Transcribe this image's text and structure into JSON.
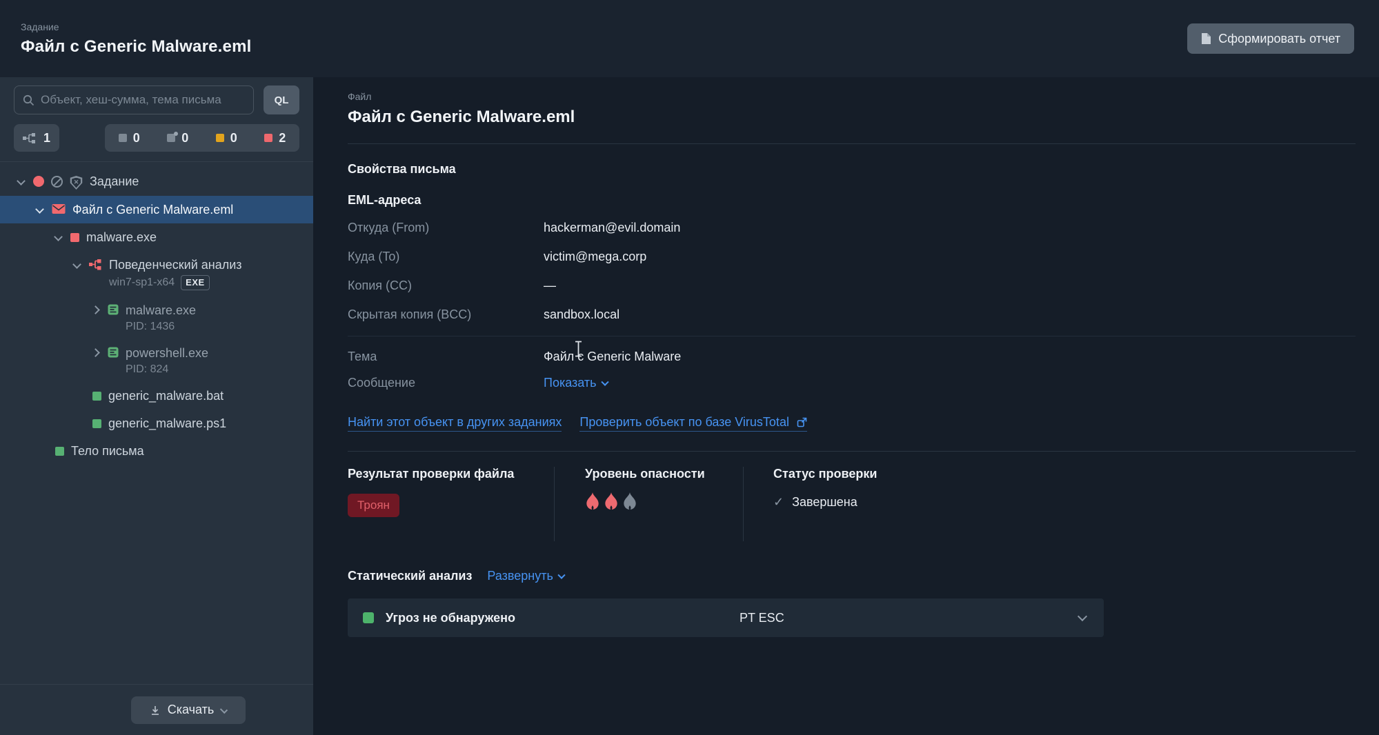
{
  "header": {
    "kicker": "Задание",
    "title": "Файл с Generic Malware.eml",
    "report_button": "Сформировать отчет"
  },
  "sidebar": {
    "search_placeholder": "Объект, хеш-сумма, тема письма",
    "ql_button": "QL",
    "tree_counter": "1",
    "severity_counters": [
      {
        "name": "neutral",
        "style": "square",
        "color": "#7e8994",
        "value": "0"
      },
      {
        "name": "unchecked",
        "style": "square-dot",
        "color": "#7e8994",
        "value": "0"
      },
      {
        "name": "suspicious",
        "style": "square",
        "color": "#e2a41d",
        "value": "0"
      },
      {
        "name": "dangerous",
        "style": "square",
        "color": "#ee686d",
        "value": "2"
      }
    ],
    "tree": [
      {
        "label": "Задание",
        "level": 0,
        "chevron": "down",
        "icons": [
          "red-dot",
          "ban",
          "shield-x"
        ]
      },
      {
        "label": "Файл с Generic Malware.eml",
        "level": 1,
        "chevron": "down",
        "icons": [
          "envelope"
        ],
        "selected": true
      },
      {
        "label": "malware.exe",
        "level": 2,
        "chevron": "down",
        "icons": [
          "red-square"
        ]
      },
      {
        "label": "Поведенческий анализ",
        "sublabel": "win7-sp1-x64",
        "badge": "EXE",
        "level": 3,
        "chevron": "down",
        "icons": [
          "behavior"
        ]
      },
      {
        "label": "malware.exe",
        "sublabel": "PID: 1436",
        "level": 4,
        "chevron": "right",
        "icons": [
          "process"
        ],
        "dimmed": true
      },
      {
        "label": "powershell.exe",
        "sublabel": "PID: 824",
        "level": 4,
        "chevron": "right",
        "icons": [
          "process"
        ],
        "dimmed": true
      },
      {
        "label": "generic_malware.bat",
        "level": 4,
        "icons": [
          "green-square"
        ]
      },
      {
        "label": "generic_malware.ps1",
        "level": 4,
        "icons": [
          "green-square"
        ]
      },
      {
        "label": "Тело письма",
        "level": 2,
        "icons": [
          "green-square"
        ]
      }
    ],
    "download_button": "Скачать"
  },
  "main": {
    "kicker": "Файл",
    "title": "Файл с Generic Malware.eml",
    "email": {
      "section_title": "Свойства письма",
      "subtitle": "EML-адреса",
      "rows": [
        {
          "label": "Откуда (From)",
          "value": "hackerman@evil.domain"
        },
        {
          "label": "Куда (To)",
          "value": "victim@mega.corp"
        },
        {
          "label": "Копия (CC)",
          "value": "—"
        },
        {
          "label": "Скрытая копия (BCC)",
          "value": "sandbox.local"
        }
      ],
      "subject": {
        "label": "Тема",
        "value": "Файл с Generic Malware"
      },
      "message": {
        "label": "Сообщение",
        "link": "Показать"
      }
    },
    "links": [
      "Найти этот объект в других заданиях",
      "Проверить объект по базе VirusTotal"
    ],
    "verdict": {
      "result_title": "Результат проверки файла",
      "result_badge": "Троян",
      "danger_title": "Уровень опасности",
      "danger_level": 2,
      "danger_max": 3,
      "status_title": "Статус проверки",
      "status_value": "Завершена"
    },
    "static_analysis": {
      "title": "Статический анализ",
      "expand_link": "Развернуть",
      "verdict": "Угроз не обнаружено",
      "engine": "PT ESC"
    }
  },
  "colors": {
    "accent_red": "#f1696e",
    "accent_green": "#57b173",
    "accent_yellow": "#e2a41d",
    "link_blue": "#4793f2",
    "selected_row": "#2a4e77",
    "badge_bg": "#701824",
    "badge_text": "#e0606a"
  }
}
